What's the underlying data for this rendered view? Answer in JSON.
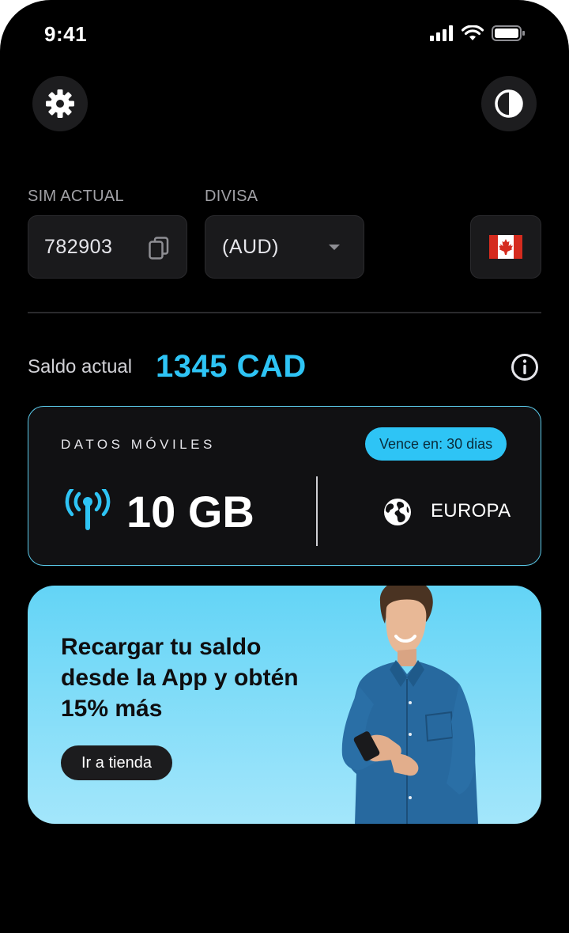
{
  "status_bar": {
    "time": "9:41"
  },
  "sim": {
    "label": "SIM ACTUAL",
    "number": "782903"
  },
  "currency": {
    "label": "DIVISA",
    "selected": "(AUD)"
  },
  "balance": {
    "label": "Saldo actual",
    "value": "1345 CAD"
  },
  "data_card": {
    "title": "DATOS MÓVILES",
    "expiry_badge": "Vence en: 30 dias",
    "amount": "10 GB",
    "region": "EUROPA"
  },
  "promo": {
    "headline": "Recargar tu saldo desde la App y obtén 15% más",
    "button_label": "Ir a tienda"
  },
  "colors": {
    "accent": "#2ec4f5",
    "background": "#000000",
    "card": "#1a1a1c",
    "promo_gradient_top": "#63d4f6",
    "promo_gradient_bottom": "#a3e6fb"
  },
  "icons": [
    "gear-icon",
    "contrast-icon",
    "copy-icon",
    "dropdown-arrow-icon",
    "canada-flag-icon",
    "info-icon",
    "signal-antenna-icon",
    "globe-icon"
  ]
}
